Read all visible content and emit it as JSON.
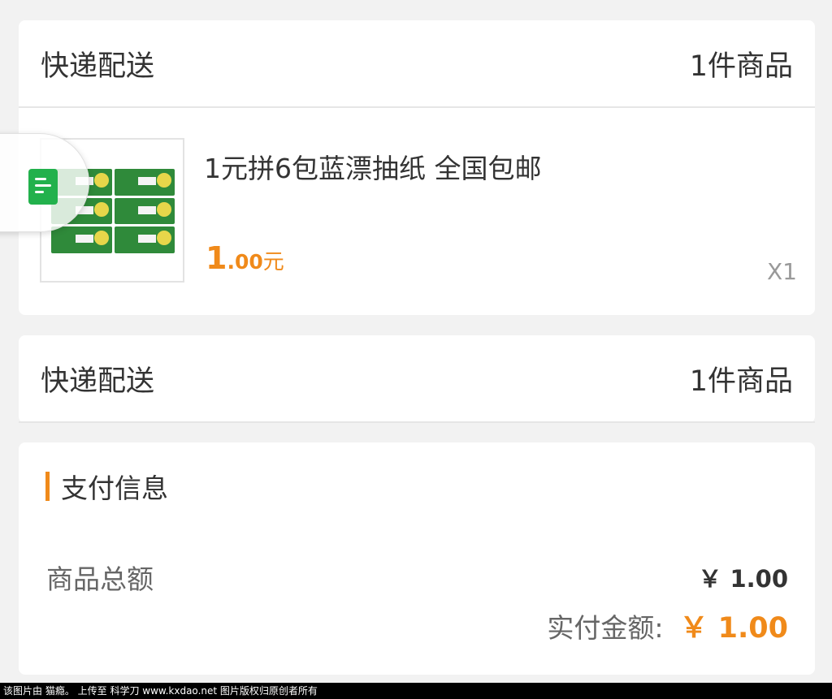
{
  "order_card": {
    "delivery_label": "快递配送",
    "item_count": "1件商品",
    "product": {
      "title": "1元拼6包蓝漂抽纸 全国包邮",
      "price_int": "1",
      "price_dec": ".00",
      "price_unit": "元",
      "quantity": "X1",
      "image": "tissue-pack-image"
    }
  },
  "delivery_card": {
    "delivery_label": "快递配送",
    "item_count": "1件商品"
  },
  "payment": {
    "title": "支付信息",
    "goods_total_label": "商品总额",
    "goods_total_value": "￥ 1.00",
    "paid_label": "实付金额:",
    "paid_value": "￥ 1.00"
  },
  "floating_widget": {
    "icon": "document-icon"
  },
  "watermark": "该图片由 猫瘾。 上传至 科学刀 www.kxdao.net 图片版权归原创者所有",
  "colors": {
    "accent": "#f08a1a",
    "background": "#f2f2f2",
    "widget_green": "#22b14c"
  }
}
